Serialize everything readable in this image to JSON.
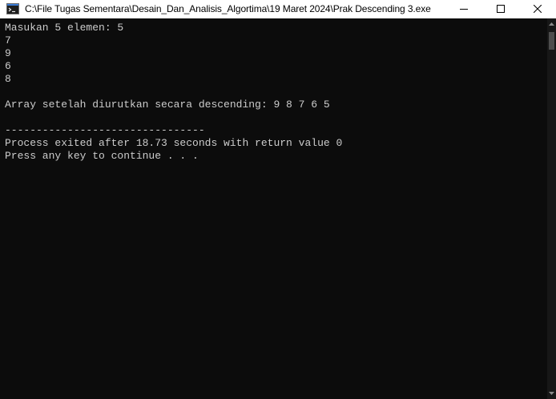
{
  "window": {
    "title": "C:\\File Tugas Sementara\\Desain_Dan_Analisis_Algortima\\19 Maret 2024\\Prak Descending 3.exe",
    "icon": "console-app-icon",
    "controls": {
      "minimize_icon": "minimize-icon",
      "maximize_icon": "maximize-icon",
      "close_icon": "close-icon"
    }
  },
  "console": {
    "lines": [
      "Masukan 5 elemen: 5",
      "7",
      "9",
      "6",
      "8",
      "",
      "Array setelah diurutkan secara descending: 9 8 7 6 5",
      "",
      "--------------------------------",
      "Process exited after 18.73 seconds with return value 0",
      "Press any key to continue . . ."
    ]
  },
  "colors": {
    "console_bg": "#0c0c0c",
    "console_fg": "#cccccc",
    "titlebar_bg": "#ffffff",
    "scrollbar_bg": "#171717",
    "scrollbar_thumb": "#4d4d4d"
  }
}
